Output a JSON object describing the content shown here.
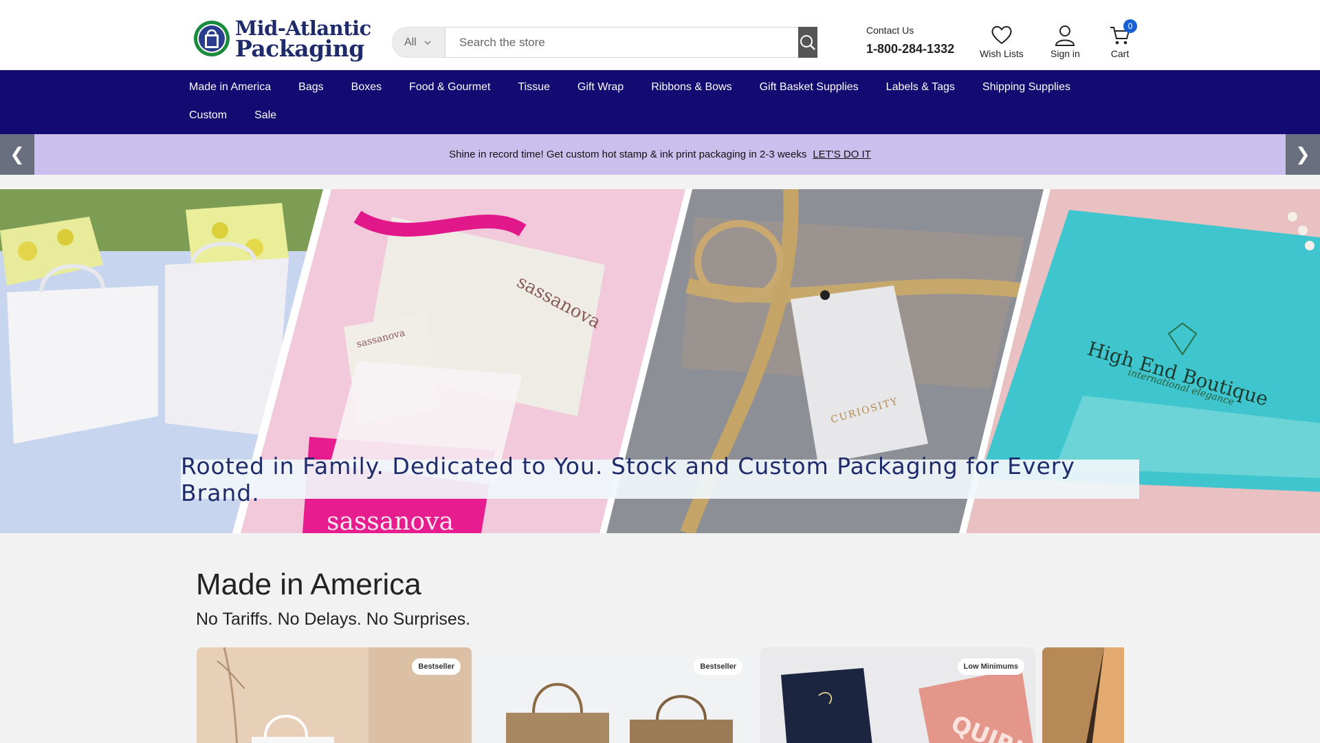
{
  "header": {
    "logo_line1": "Mid-Atlantic",
    "logo_line2": "Packaging",
    "search_category": "All",
    "search_placeholder": "Search the store",
    "contact_label": "Contact Us",
    "contact_phone": "1-800-284-1332",
    "wishlist_label": "Wish Lists",
    "signin_label": "Sign in",
    "cart_label": "Cart",
    "cart_count": "0"
  },
  "nav": {
    "row1": [
      "Made in America",
      "Bags",
      "Boxes",
      "Food & Gourmet",
      "Tissue",
      "Gift Wrap",
      "Ribbons & Bows",
      "Gift Basket Supplies",
      "Labels & Tags",
      "Shipping Supplies"
    ],
    "row2": [
      "Custom",
      "Sale"
    ]
  },
  "promo": {
    "text": "Shine in record time! Get custom hot stamp & ink print packaging in 2-3 weeks",
    "cta": "LET'S DO IT",
    "prev_arrow": "❮",
    "next_arrow": "❯"
  },
  "hero": {
    "banner_text": "Rooted in Family. Dedicated to You. Stock and Custom Packaging for Every Brand.",
    "image_text": [
      "sassanova",
      "sassanova",
      "sassanova",
      "CURIOSITY",
      "High End Boutique",
      "international elegance"
    ]
  },
  "section": {
    "title": "Made in America",
    "subtitle": "No Tariffs. No Delays. No Surprises."
  },
  "cards": [
    {
      "badge": "Bestseller"
    },
    {
      "badge": "Bestseller"
    },
    {
      "badge": "Low Minimums"
    },
    {
      "badge": ""
    }
  ],
  "colors": {
    "nav_bg": "#130a72",
    "promo_bg": "#cbbfee",
    "brand_text": "#1f2b6b",
    "cart_badge": "#1b5fd6"
  }
}
